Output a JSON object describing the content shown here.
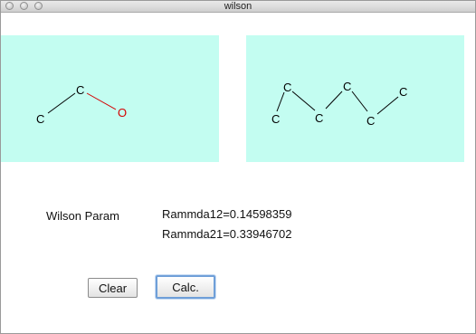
{
  "window": {
    "title": "wilson"
  },
  "molecule1": {
    "atoms": [
      {
        "symbol": "C",
        "color": "#000000"
      },
      {
        "symbol": "C",
        "color": "#000000"
      },
      {
        "symbol": "O",
        "color": "#d40000"
      }
    ]
  },
  "molecule2": {
    "atoms": [
      {
        "symbol": "C",
        "color": "#000000"
      },
      {
        "symbol": "C",
        "color": "#000000"
      },
      {
        "symbol": "C",
        "color": "#000000"
      },
      {
        "symbol": "C",
        "color": "#000000"
      },
      {
        "symbol": "C",
        "color": "#000000"
      },
      {
        "symbol": "C",
        "color": "#000000"
      }
    ]
  },
  "results": {
    "param_label": "Wilson Param",
    "rammda12": "Rammda12=0.14598359",
    "rammda21": "Rammda21=0.33946702"
  },
  "buttons": {
    "clear_label": "Clear",
    "calc_label": "Calc."
  },
  "colors": {
    "panel_background": "#c3fdf1",
    "oxygen": "#d40000",
    "bond_carbon_oxygen": "#d40000"
  }
}
